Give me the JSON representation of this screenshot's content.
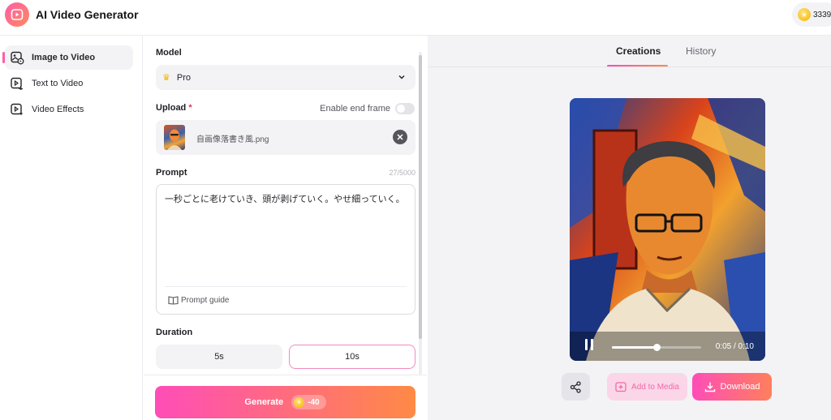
{
  "app": {
    "title": "AI Video Generator",
    "credits": "3339"
  },
  "sidebar": {
    "items": [
      {
        "label": "Image to Video",
        "icon": "image-video-icon",
        "active": true
      },
      {
        "label": "Text to Video",
        "icon": "text-video-icon",
        "active": false
      },
      {
        "label": "Video Effects",
        "icon": "video-effects-icon",
        "active": false
      }
    ]
  },
  "form": {
    "model_label": "Model",
    "model_value": "Pro",
    "upload_label": "Upload",
    "required_mark": "*",
    "end_frame_label": "Enable end frame",
    "end_frame_enabled": false,
    "file_name": "自画像落書き風.png",
    "prompt_label": "Prompt",
    "prompt_counter": "27/5000",
    "prompt_text": "一秒ごとに老けていき、頭が剥げていく。やせ細っていく。",
    "prompt_guide": "Prompt guide",
    "duration_label": "Duration",
    "durations": [
      "5s",
      "10s"
    ],
    "selected_duration": "10s",
    "generate_label": "Generate",
    "generate_cost": "-40"
  },
  "preview": {
    "tabs": [
      "Creations",
      "History"
    ],
    "active_tab": "Creations",
    "time": "0:05 / 0:10",
    "progress_fraction": 0.5,
    "add_media_label": "Add to Media",
    "download_label": "Download"
  },
  "colors": {
    "accent_pink": "#ff4db8",
    "accent_orange": "#ff8a45"
  }
}
